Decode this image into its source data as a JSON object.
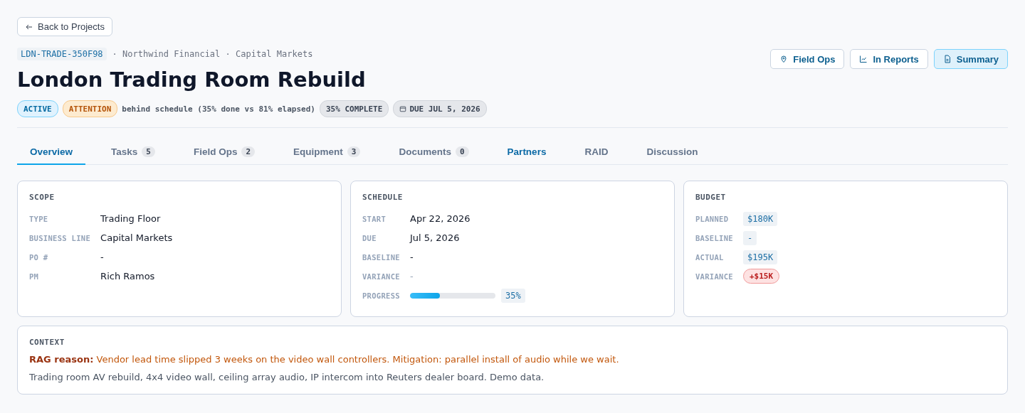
{
  "back_button": {
    "label": "Back to Projects"
  },
  "header": {
    "code": "LDN-TRADE-350F98",
    "meta": "· Northwind Financial · Capital Markets",
    "title": "London Trading Room Rebuild"
  },
  "actions": [
    {
      "label": "Field Ops",
      "kind": "map",
      "selected": false
    },
    {
      "label": "In Reports",
      "kind": "reports",
      "selected": false
    },
    {
      "label": "Summary",
      "kind": "summary",
      "selected": true
    }
  ],
  "badges": [
    {
      "kind": "active",
      "label": "ACTIVE"
    },
    {
      "kind": "attention",
      "label": "ATTENTION"
    },
    {
      "kind": "note",
      "label": "behind schedule (35% done vs 81% elapsed)"
    },
    {
      "kind": "neutral",
      "label": "35% COMPLETE"
    },
    {
      "kind": "date",
      "label": "DUE JUL 5, 2026"
    }
  ],
  "tabs": [
    {
      "label": "Overview",
      "selected": true,
      "highlighted": false
    },
    {
      "label": "Tasks",
      "count": "5",
      "selected": false,
      "highlighted": false
    },
    {
      "label": "Field Ops",
      "count": "2",
      "selected": false,
      "highlighted": false
    },
    {
      "label": "Equipment",
      "count": "3",
      "selected": false,
      "highlighted": false
    },
    {
      "label": "Documents",
      "count": "0",
      "selected": false,
      "highlighted": false
    },
    {
      "label": "Partners",
      "selected": false,
      "highlighted": true
    },
    {
      "label": "RAID",
      "selected": false,
      "highlighted": false
    },
    {
      "label": "Discussion",
      "selected": false,
      "highlighted": false
    }
  ],
  "scope": {
    "title": "SCOPE",
    "rows": [
      {
        "label": "TYPE",
        "value": "Trading Floor",
        "kind": "text"
      },
      {
        "label": "BUSINESS LINE",
        "value": "Capital Markets",
        "kind": "text"
      },
      {
        "label": "PO #",
        "value": "-",
        "kind": "text"
      },
      {
        "label": "PM",
        "value": "Rich Ramos",
        "kind": "text"
      }
    ]
  },
  "schedule": {
    "title": "SCHEDULE",
    "rows": [
      {
        "label": "START",
        "value": "Apr 22, 2026",
        "kind": "text"
      },
      {
        "label": "DUE",
        "value": "Jul 5, 2026",
        "kind": "text"
      },
      {
        "label": "BASELINE",
        "value": "-",
        "kind": "text"
      },
      {
        "label": "VARIANCE",
        "value": "-",
        "kind": "muted"
      },
      {
        "label": "PROGRESS",
        "value": "35%",
        "kind": "progress",
        "level": 0.35
      }
    ]
  },
  "budget": {
    "title": "BUDGET",
    "rows": [
      {
        "label": "PLANNED",
        "value": "$180K",
        "kind": "code"
      },
      {
        "label": "BASELINE",
        "value": "-",
        "kind": "code"
      },
      {
        "label": "ACTUAL",
        "value": "$195K",
        "kind": "code"
      },
      {
        "label": "VARIANCE",
        "value": "+$15K",
        "kind": "danger"
      }
    ]
  },
  "context": {
    "title": "CONTEXT",
    "rag_reason": "**RAG reason:** Vendor lead time slipped 3 weeks on the video wall controllers. Mitigation: parallel install of audio while we wait.",
    "description": "Trading room AV rebuild, 4x4 video wall, ceiling array audio, IP intercom into Reuters dealer board. Demo data."
  }
}
